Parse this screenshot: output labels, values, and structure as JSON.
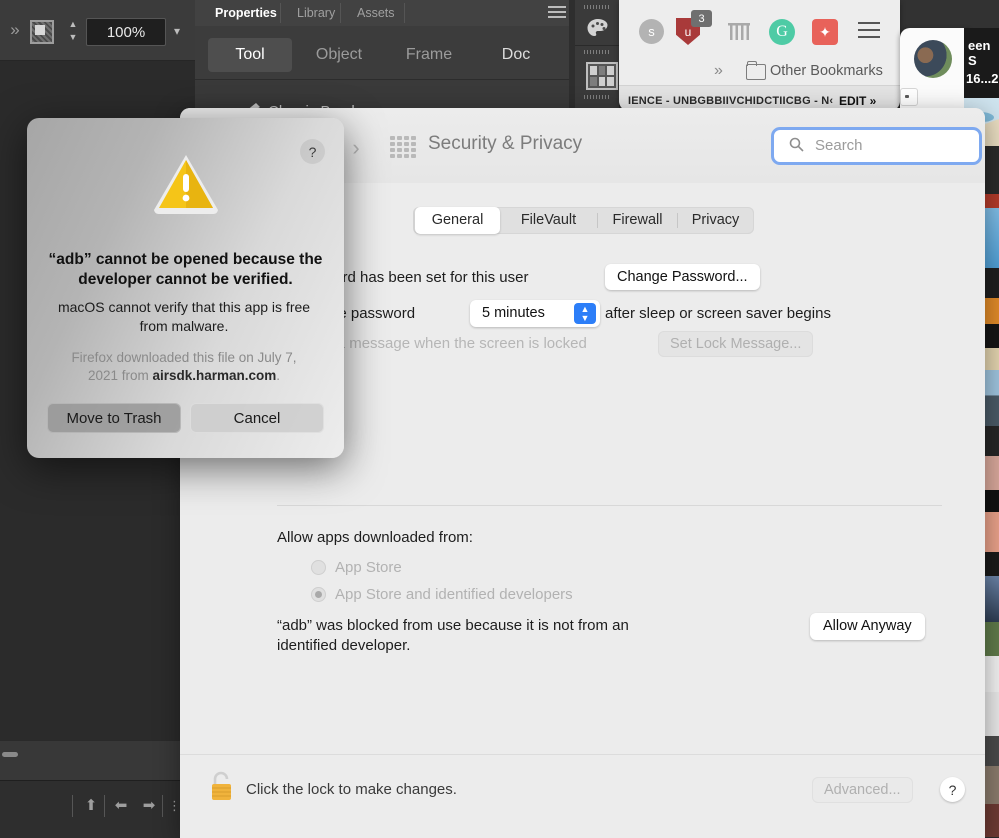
{
  "creative_app": {
    "zoom_value": "100%",
    "panel_tabs": [
      "Properties",
      "Library",
      "Assets"
    ],
    "sub_tabs": [
      "Tool",
      "Object",
      "Frame",
      "Doc"
    ],
    "brush_label": "Classic Brush",
    "icons": [
      "artboard-icon",
      "stepper-icon",
      "chevron-down-icon",
      "panel-menu-icon",
      "brush-icon",
      "palette-icon",
      "swatches-icon"
    ]
  },
  "browser": {
    "extensions": [
      {
        "name": "s-extension-icon",
        "label": "s"
      },
      {
        "name": "ublock-icon",
        "label": "u",
        "badge": "3"
      },
      {
        "name": "comb-icon",
        "label": ""
      },
      {
        "name": "grammarly-icon",
        "label": "G"
      },
      {
        "name": "magic-wand-icon",
        "label": "✦"
      }
    ],
    "menu_icon": "hamburger-menu-icon",
    "bookmarks_overflow": "»",
    "other_bookmarks": "Other Bookmarks",
    "edit_bar_text": "IENCE - UNBGBBIIVCHIDCTIICBG - N‹",
    "edit_link": "EDIT »"
  },
  "thumbnails": {
    "dark_line1": "een S",
    "dark_line2": " 16...2"
  },
  "prefs": {
    "title": "Security & Privacy",
    "search_placeholder": "Search",
    "tabs": [
      "General",
      "FileVault",
      "Firewall",
      "Privacy"
    ],
    "active_tab": "General",
    "password_row": {
      "text": "assword has been set for this user",
      "button": "Change Password..."
    },
    "require_password_row": {
      "prefix": "equire password",
      "selected": "5 minutes",
      "suffix": "after sleep or screen saver begins"
    },
    "lock_message_row": {
      "text": "how a message when the screen is locked",
      "button": "Set Lock Message..."
    },
    "allow_section": {
      "label": "Allow apps downloaded from:",
      "options": [
        "App Store",
        "App Store and identified developers"
      ],
      "selected_index": 1,
      "blocked_message": "“adb” was blocked from use because it is not from an identified developer.",
      "allow_button": "Allow Anyway"
    },
    "footer": {
      "lock_text": "Click the lock to make changes.",
      "advanced_button": "Advanced...",
      "help_button": "?"
    }
  },
  "dialog": {
    "title": "“adb” cannot be opened because the developer cannot be verified.",
    "subtitle": "macOS cannot verify that this app is free from malware.",
    "note_prefix": "Firefox downloaded this file on July 7, 2021 from ",
    "note_source": "airsdk.harman.com",
    "note_suffix": ".",
    "help_button": "?",
    "buttons": {
      "destructive": "Move to Trash",
      "cancel": "Cancel"
    }
  },
  "colors": {
    "accent_blue": "#2c7ef8",
    "focus_ring": "#7ea9f0",
    "warning_yellow": "#f5c518",
    "prefs_bg": "#ececec",
    "app_dark": "#3a3a3a"
  }
}
